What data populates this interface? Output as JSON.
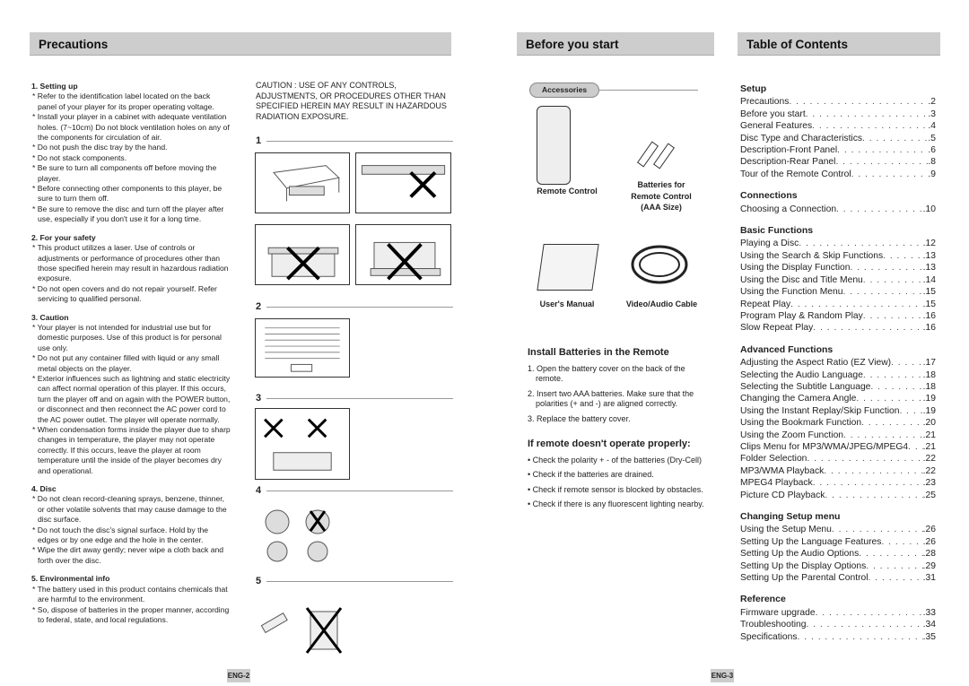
{
  "headers": {
    "precautions": "Precautions",
    "before": "Before you start",
    "toc": "Table of Contents"
  },
  "precautions": {
    "sections": [
      {
        "title": "1. Setting up",
        "items": [
          "Refer to the identification label located on the back panel of your player for its proper operating voltage.",
          "Install your player in a cabinet with adequate ventilation holes. (7~10cm) Do not block ventilation holes on any of the components for circulation of air.",
          "Do not push the disc tray by the hand.",
          "Do not stack components.",
          "Be sure to turn all components off before moving the player.",
          "Before connecting other components to this player, be sure to turn them off.",
          "Be sure to remove the disc and turn off the player after use, especially if you don't use it for a long time."
        ]
      },
      {
        "title": "2. For your safety",
        "items": [
          "This product utilizes a laser. Use of controls or adjustments or performance of procedures other than those specified herein may result in hazardous radiation exposure.",
          "Do not open covers and do not repair yourself. Refer servicing to qualified personal."
        ]
      },
      {
        "title": "3. Caution",
        "items": [
          "Your player is not intended for industrial use but for domestic purposes. Use of this product is for personal use only.",
          "Do not put any container filled with liquid or any small metal objects on the player.",
          "Exterior influences such as lightning and static electricity can affect normal operation of this player. If this occurs, turn the player off and on again with the POWER button, or disconnect and then reconnect the AC power cord to the AC power outlet. The player will operate normally.",
          "When condensation forms inside the player due to sharp changes in temperature, the player may not operate correctly. If this occurs, leave the player at room temperature until the inside of the player becomes dry and operational."
        ]
      },
      {
        "title": "4. Disc",
        "items": [
          "Do not clean record-cleaning sprays, benzene, thinner, or other volatile solvents that may cause damage to the disc surface.",
          "Do not touch the disc's signal surface. Hold by the edges or by one edge and the hole in the center.",
          "Wipe the dirt away gently; never wipe a cloth back and forth over the disc."
        ]
      },
      {
        "title": "5. Environmental info",
        "items": [
          "The battery used in this product contains chemicals that are harmful to the environment.",
          "So, dispose of batteries in the proper manner, according to federal, state, and local regulations."
        ]
      }
    ],
    "caution": "CAUTION : USE OF ANY CONTROLS, ADJUSTMENTS, OR PROCEDURES OTHER THAN SPECIFIED HEREIN MAY RESULT IN HAZARDOUS RADIATION EXPOSURE.",
    "figures": [
      "1",
      "2",
      "3",
      "4",
      "5"
    ]
  },
  "before": {
    "accessories": "Accessories",
    "remote": "Remote Control",
    "batteries": [
      "Batteries for",
      "Remote Control",
      "(AAA Size)"
    ],
    "manual": "User's Manual",
    "cable": "Video/Audio Cable",
    "install_title": "Install Batteries in the Remote",
    "install_steps": [
      "1. Open the battery cover on the back of the remote.",
      "2. Insert two AAA batteries. Make sure that the polarities (+ and -) are aligned correctly.",
      "3. Replace the battery cover."
    ],
    "trouble_title": "If remote doesn't operate properly:",
    "trouble_items": [
      "• Check the polarity + - of the batteries (Dry-Cell)",
      "• Check if the batteries are drained.",
      "• Check if remote sensor is blocked by obstacles.",
      "• Check if there is any fluorescent lighting nearby."
    ]
  },
  "toc": [
    {
      "title": "Setup",
      "entries": [
        [
          "Precautions",
          "2"
        ],
        [
          "Before you start",
          "3"
        ],
        [
          "General Features",
          "4"
        ],
        [
          "Disc Type and Characteristics",
          "5"
        ],
        [
          "Description-Front Panel",
          "6"
        ],
        [
          "Description-Rear Panel",
          "8"
        ],
        [
          "Tour of the Remote Control",
          "9"
        ]
      ]
    },
    {
      "title": "Connections",
      "entries": [
        [
          "Choosing a Connection",
          "10"
        ]
      ]
    },
    {
      "title": "Basic Functions",
      "entries": [
        [
          "Playing a Disc",
          "12"
        ],
        [
          "Using the Search & Skip Functions",
          "13"
        ],
        [
          "Using the Display Function",
          "13"
        ],
        [
          "Using the Disc and Title Menu",
          "14"
        ],
        [
          "Using the Function Menu",
          "15"
        ],
        [
          "Repeat Play",
          "15"
        ],
        [
          "Program Play & Random Play",
          "16"
        ],
        [
          "Slow Repeat Play",
          "16"
        ]
      ]
    },
    {
      "title": "Advanced Functions",
      "entries": [
        [
          "Adjusting the Aspect Ratio (EZ View)",
          "17"
        ],
        [
          "Selecting the Audio Language",
          "18"
        ],
        [
          "Selecting the Subtitle Language",
          "18"
        ],
        [
          "Changing the Camera Angle",
          "19"
        ],
        [
          "Using the Instant Replay/Skip Function",
          "19"
        ],
        [
          "Using the Bookmark Function",
          "20"
        ],
        [
          "Using the Zoom Function",
          "21"
        ],
        [
          "Clips Menu for MP3/WMA/JPEG/MPEG4",
          "21"
        ],
        [
          "Folder Selection",
          "22"
        ],
        [
          "MP3/WMA Playback",
          "22"
        ],
        [
          "MPEG4 Playback",
          "23"
        ],
        [
          "Picture CD Playback",
          "25"
        ]
      ]
    },
    {
      "title": "Changing Setup menu",
      "entries": [
        [
          "Using the Setup Menu",
          "26"
        ],
        [
          "Setting Up the Language Features",
          "26"
        ],
        [
          "Setting Up the Audio Options",
          "28"
        ],
        [
          "Setting Up the Display Options",
          "29"
        ],
        [
          "Setting Up the Parental Control",
          "31"
        ]
      ]
    },
    {
      "title": "Reference",
      "entries": [
        [
          "Firmware upgrade",
          "33"
        ],
        [
          "Troubleshooting",
          "34"
        ],
        [
          "Specifications",
          "35"
        ]
      ]
    }
  ],
  "footer": {
    "left": "ENG-2",
    "right": "ENG-3"
  }
}
